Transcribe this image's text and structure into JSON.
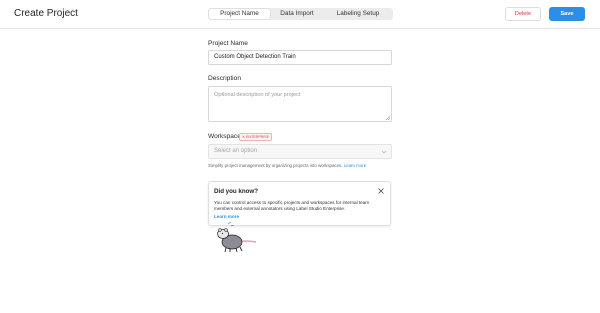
{
  "header": {
    "title": "Create Project",
    "tabs": [
      {
        "label": "Project Name",
        "active": true
      },
      {
        "label": "Data Import",
        "active": false
      },
      {
        "label": "Labeling Setup",
        "active": false
      }
    ],
    "delete_label": "Delete",
    "save_label": "Save"
  },
  "form": {
    "project_name_label": "Project Name",
    "project_name_value": "Custom Object Detection Train",
    "description_label": "Description",
    "description_placeholder": "Optional description of your project",
    "workspace_label": "Workspace",
    "workspace_badge": "Enterprise",
    "workspace_placeholder": "Select an option",
    "workspace_help": "Simplify project management by organizing projects into workspaces.",
    "workspace_help_link": "Learn more"
  },
  "tip": {
    "title": "Did you know?",
    "text": "You can control access to specific projects and workspaces for internal team members and external annotators using Label Studio Enterprise.",
    "link": "Learn more"
  },
  "colors": {
    "accent": "#2b8ee8",
    "danger": "#d9363e"
  },
  "icons": [
    "close-icon",
    "chevron-down-icon",
    "resize-grip-icon",
    "enterprise-badge-icon",
    "mascot-illustration"
  ]
}
